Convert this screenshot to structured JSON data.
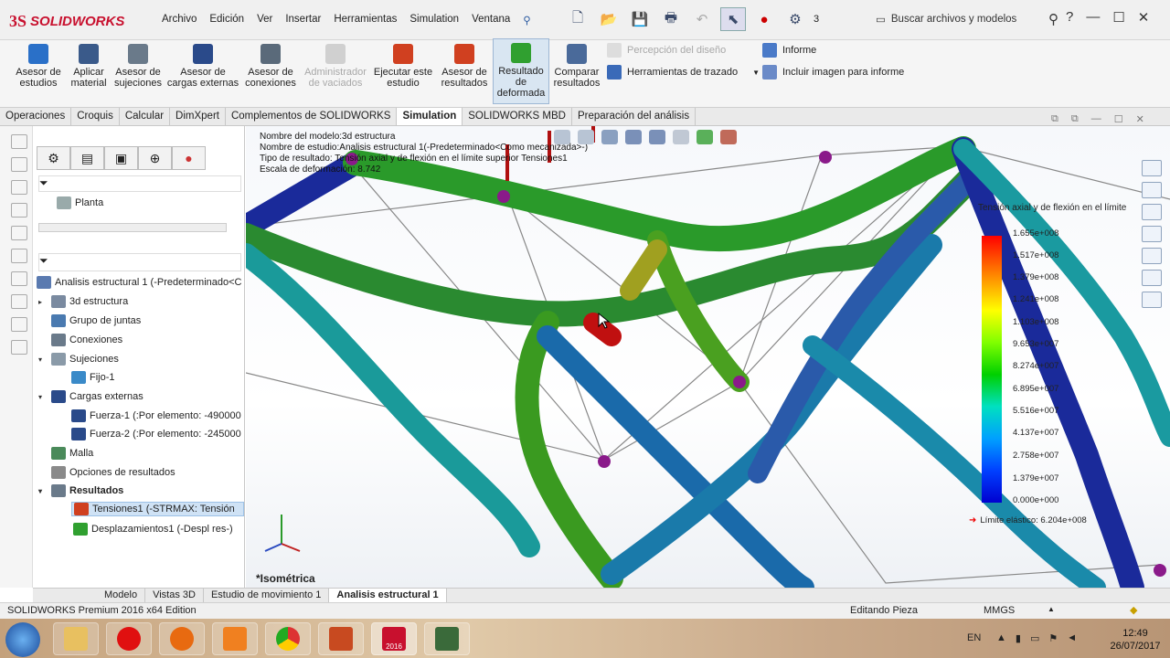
{
  "app": {
    "logo_ds": "3S",
    "logo_name": "SOLIDWORKS"
  },
  "menu": [
    "Archivo",
    "Edición",
    "Ver",
    "Insertar",
    "Herramientas",
    "Simulation",
    "Ventana"
  ],
  "toolbar": {
    "digit": "3",
    "search_placeholder": "Buscar archivos y modelos",
    "help": "?"
  },
  "ribbon": {
    "buttons": [
      {
        "label": "Asesor de estudios",
        "color": "#2a70c8",
        "enabled": true
      },
      {
        "label": "Aplicar material",
        "color": "#3a5a8a",
        "enabled": true
      },
      {
        "label": "Asesor de sujeciones",
        "color": "#6a7a8a",
        "enabled": true
      },
      {
        "label": "Asesor de cargas externas",
        "color": "#2a4a8a",
        "enabled": true
      },
      {
        "label": "Asesor de conexiones",
        "color": "#5a6a7a",
        "enabled": true
      },
      {
        "label": "Administrador de vaciados",
        "color": "#b0b0b0",
        "enabled": false
      },
      {
        "label": "Ejecutar este estudio",
        "color": "#d04020",
        "enabled": true
      },
      {
        "label": "Asesor de resultados",
        "color": "#d04020",
        "enabled": true
      },
      {
        "label": "Resultado de deformada",
        "color": "#30a030",
        "enabled": true,
        "selected": true
      },
      {
        "label": "Comparar resultados",
        "color": "#4a6a9a",
        "enabled": true
      }
    ],
    "small": [
      {
        "label": "Percepción del diseño",
        "enabled": false
      },
      {
        "label": "Herramientas de trazado",
        "enabled": true
      },
      {
        "label": "Informe",
        "enabled": true
      },
      {
        "label": "Incluir imagen para informe",
        "enabled": true
      }
    ]
  },
  "tabs": [
    "Operaciones",
    "Croquis",
    "Calcular",
    "DimXpert",
    "Complementos de SOLIDWORKS",
    "Simulation",
    "SOLIDWORKS MBD",
    "Preparación del análisis"
  ],
  "active_tab": "Simulation",
  "tree": {
    "top_items": [
      "Planta"
    ],
    "study": "Analisis estructural 1 (-Predeterminado<C",
    "items": [
      {
        "label": "3d estructura",
        "indent": 1,
        "exp": "▸"
      },
      {
        "label": "Grupo de juntas",
        "indent": 1,
        "exp": ""
      },
      {
        "label": "Conexiones",
        "indent": 1,
        "exp": ""
      },
      {
        "label": "Sujeciones",
        "indent": 1,
        "exp": "▾"
      },
      {
        "label": "Fijo-1",
        "indent": 2,
        "exp": ""
      },
      {
        "label": "Cargas externas",
        "indent": 1,
        "exp": "▾"
      },
      {
        "label": "Fuerza-1 (:Por elemento: -490000",
        "indent": 2,
        "exp": ""
      },
      {
        "label": "Fuerza-2 (:Por elemento: -245000",
        "indent": 2,
        "exp": ""
      },
      {
        "label": "Malla",
        "indent": 1,
        "exp": ""
      },
      {
        "label": "Opciones de resultados",
        "indent": 1,
        "exp": ""
      },
      {
        "label": "Resultados",
        "indent": 1,
        "exp": "▾",
        "bold": true
      },
      {
        "label": "Tensiones1 (-STRMAX: Tensión",
        "indent": 2,
        "exp": "",
        "selected": true
      },
      {
        "label": "Desplazamientos1 (-Despl res-)",
        "indent": 2,
        "exp": ""
      }
    ]
  },
  "viewport": {
    "info": [
      "Nombre del modelo:3d estructura",
      "Nombre de estudio:Analisis estructural 1(-Predeterminado<Como mecanizada>-)",
      "Tipo de resultado: Tensión axial y de flexión en el límite superior Tensiones1",
      "Escala de deformación: 8.742"
    ],
    "view_name": "*Isométrica",
    "legend_title": "Tensión axial y de flexión en el límite",
    "legend_values": [
      "1.655e+008",
      "1.517e+008",
      "1.379e+008",
      "1.241e+008",
      "1.103e+008",
      "9.653e+007",
      "8.274e+007",
      "6.895e+007",
      "5.516e+007",
      "4.137e+007",
      "2.758e+007",
      "1.379e+007",
      "0.000e+000"
    ],
    "limit": "Límite elástico: 6.204e+008"
  },
  "bottom_tabs": [
    "Modelo",
    "Vistas 3D",
    "Estudio de movimiento 1",
    "Analisis estructural 1"
  ],
  "status": {
    "left": "SOLIDWORKS Premium 2016 x64 Edition",
    "mode": "Editando Pieza",
    "units": "MMGS"
  },
  "taskbar": {
    "lang": "EN",
    "time": "12:49",
    "date": "26/07/2017",
    "sw_version": "2016"
  }
}
